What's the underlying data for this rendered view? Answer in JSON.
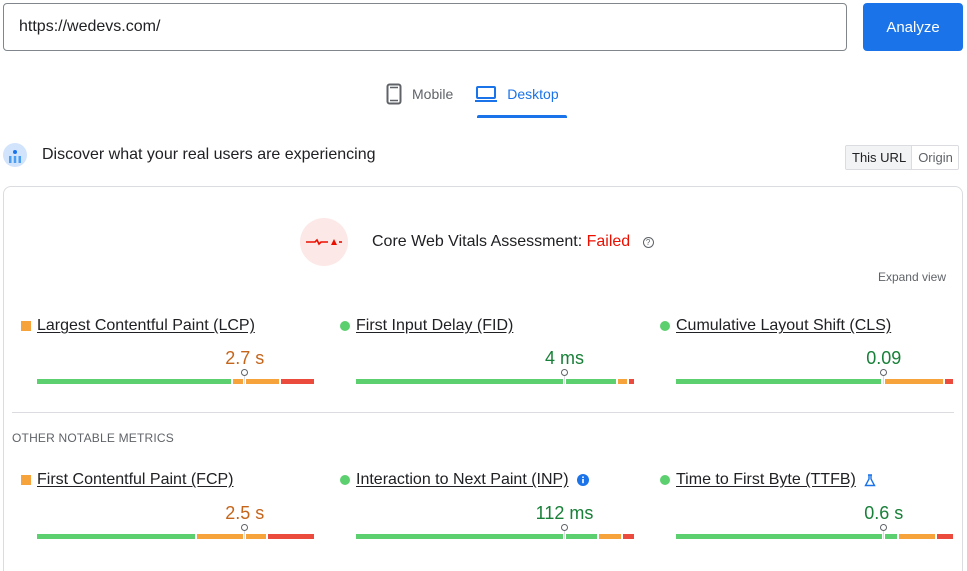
{
  "url_bar": {
    "value": "https://wedevs.com/",
    "analyze_label": "Analyze"
  },
  "device_tabs": [
    {
      "label": "Mobile",
      "icon": "smartphone-icon",
      "active": false
    },
    {
      "label": "Desktop",
      "icon": "laptop-icon",
      "active": true
    }
  ],
  "field_data": {
    "title": "Discover what your real users are experiencing",
    "scope_toggle": [
      {
        "label": "This URL",
        "active": true
      },
      {
        "label": "Origin",
        "active": false
      }
    ]
  },
  "assessment": {
    "label": "Core Web Vitals Assessment:",
    "status": "Failed",
    "status_color": "#eb0f00",
    "expand_label": "Expand view"
  },
  "colors": {
    "good": "#5ccf6e",
    "needs_improvement": "#f6a33b",
    "poor": "#eb4b3d",
    "good_text": "#188038",
    "ni_text": "#c5651b",
    "accent": "#1a73e8"
  },
  "core_metrics": [
    {
      "name": "Largest Contentful Paint (LCP)",
      "value": "2.7 s",
      "rating": "needs-improvement",
      "distribution": {
        "good": 71,
        "needs_improvement": 17,
        "poor": 12
      },
      "marker_pct": 75
    },
    {
      "name": "First Input Delay (FID)",
      "value": "4 ms",
      "rating": "good",
      "distribution": {
        "good": 95,
        "needs_improvement": 3,
        "poor": 2
      },
      "marker_pct": 75
    },
    {
      "name": "Cumulative Layout Shift (CLS)",
      "value": "0.09",
      "rating": "good",
      "distribution": {
        "good": 75,
        "needs_improvement": 22,
        "poor": 3
      },
      "marker_pct": 75
    }
  ],
  "other_section_label": "OTHER NOTABLE METRICS",
  "other_metrics": [
    {
      "name": "First Contentful Paint (FCP)",
      "value": "2.5 s",
      "rating": "needs-improvement",
      "distribution": {
        "good": 58,
        "needs_improvement": 25,
        "poor": 17
      },
      "marker_pct": 75,
      "extra_icon": null
    },
    {
      "name": "Interaction to Next Paint (INP)",
      "value": "112 ms",
      "rating": "good",
      "distribution": {
        "good": 88,
        "needs_improvement": 8,
        "poor": 4
      },
      "marker_pct": 75,
      "extra_icon": "info-icon"
    },
    {
      "name": "Time to First Byte (TTFB)",
      "value": "0.6 s",
      "rating": "good",
      "distribution": {
        "good": 81,
        "needs_improvement": 13,
        "poor": 6
      },
      "marker_pct": 75,
      "extra_icon": "experimental-flask-icon"
    }
  ]
}
